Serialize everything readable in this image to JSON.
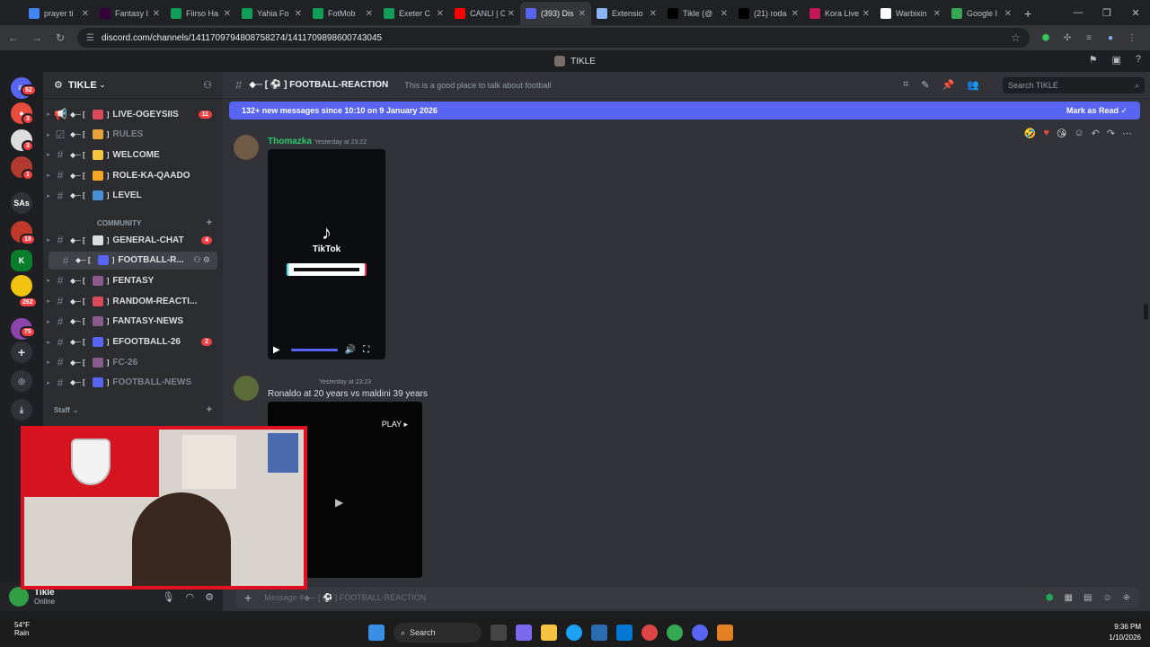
{
  "browser": {
    "tabs": [
      {
        "label": "prayer ti",
        "color": "#4285f4"
      },
      {
        "label": "Fantasy I",
        "color": "#37003c"
      },
      {
        "label": "Fiirso Ha",
        "color": "#0f9d58"
      },
      {
        "label": "Yahia Fo",
        "color": "#0f9d58"
      },
      {
        "label": "FotMob",
        "color": "#0f9d58"
      },
      {
        "label": "Exeter C",
        "color": "#0f9d58"
      },
      {
        "label": "CANLI | C",
        "color": "#ff0000"
      },
      {
        "label": "(393) Dis",
        "color": "#5865f2",
        "active": true
      },
      {
        "label": "Extensio",
        "color": "#8ab4f8"
      },
      {
        "label": "Tikle (@",
        "color": "#000000"
      },
      {
        "label": "(21) roda",
        "color": "#000000"
      },
      {
        "label": "Kora Live",
        "color": "#c2185b"
      },
      {
        "label": "Warbixin",
        "color": "#ffffff"
      },
      {
        "label": "Google I",
        "color": "#34a853"
      }
    ],
    "url": "discord.com/channels/1411709794808758274/1411709898600743045"
  },
  "discord": {
    "server_title": "TIKLE",
    "server_name": "TIKLE",
    "channels": [
      {
        "name": "LIVE-OGEYSIIS",
        "badge": "11",
        "icon": "megaphone",
        "color": "#d84b5a",
        "kind": "announce"
      },
      {
        "name": "RULES",
        "icon": "rules",
        "color": "#e9a23b",
        "kind": "rules",
        "muted": true
      },
      {
        "name": "WELCOME",
        "icon": "wave",
        "color": "#f5c542",
        "kind": "text"
      },
      {
        "name": "ROLE-KA-QAADO",
        "icon": "circle",
        "color": "#f5a623",
        "kind": "text"
      },
      {
        "name": "LEVEL",
        "icon": "level",
        "color": "#4a90d9",
        "kind": "text"
      }
    ],
    "category_community": "COMMUNITY",
    "community_channels": [
      {
        "name": "GENERAL-CHAT",
        "badge": "4",
        "color": "#dbdee1"
      },
      {
        "name": "FOOTBALL-R...",
        "color": "#5865f2",
        "selected": true
      },
      {
        "name": "FENTASY",
        "color": "#8b5a8c"
      },
      {
        "name": "RANDOM-REACTI...",
        "color": "#d84b5a"
      },
      {
        "name": "FANTASY-NEWS",
        "color": "#8b5a8c"
      },
      {
        "name": "EFOOTBALL-26",
        "badge": "2",
        "color": "#5865f2"
      },
      {
        "name": "FC-26",
        "color": "#8b5a8c",
        "muted": true
      },
      {
        "name": "FOOTBALL-NEWS",
        "color": "#5865f2",
        "muted": true
      }
    ],
    "category_staff": "Staff",
    "user": {
      "name": "Tikle",
      "status": "Online"
    },
    "channel_header": {
      "name": "FOOTBALL-REACTION",
      "topic": "This is a good place to talk about football",
      "search_placeholder": "Search TIKLE"
    },
    "new_messages_bar": {
      "text": "132+ new messages since 10:10 on 9 January 2026",
      "action": "Mark as Read"
    },
    "messages": [
      {
        "author": "Thomazka",
        "timestamp": "Yesterday at 23:22",
        "attachment": "TikTok"
      },
      {
        "author": "",
        "timestamp": "Yesterday at 23:23",
        "text": "Ronaldo at 20 years vs maldini 39 years",
        "video_label": "PLAY"
      }
    ],
    "composer_placeholder": "Message #◆─ [ ⚽ ] FOOTBALL-REACTION"
  },
  "taskbar": {
    "weather_temp": "54°F",
    "weather_desc": "Rain",
    "search_label": "Search",
    "time": "9:36 PM",
    "date": "1/10/2026"
  }
}
